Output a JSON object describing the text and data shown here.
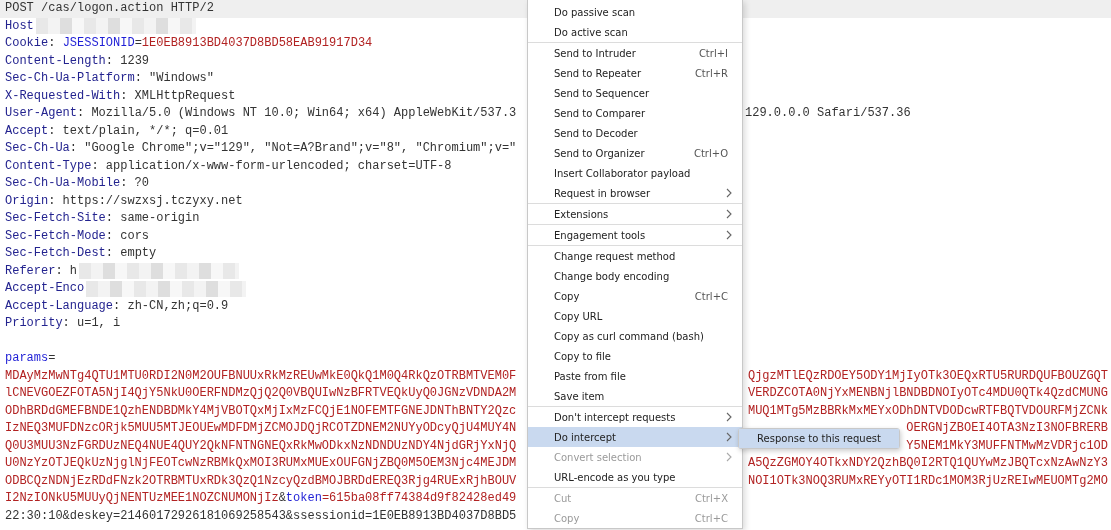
{
  "editor": {
    "lines": [
      {
        "kind": "header",
        "current": true,
        "redacted": false,
        "text": [
          {
            "kind": "plain",
            "text": "POST /cas/logon.action HTTP/2"
          }
        ]
      },
      {
        "kind": "header",
        "current": false,
        "redacted": true,
        "text": [
          {
            "kind": "key",
            "text": "Host"
          }
        ]
      },
      {
        "kind": "header",
        "current": false,
        "redacted": false,
        "text": [
          {
            "kind": "key",
            "text": "Cookie"
          },
          {
            "kind": "plain",
            "text": ": "
          },
          {
            "kind": "param",
            "text": "JSESSIONID"
          },
          {
            "kind": "plain",
            "text": "="
          },
          {
            "kind": "value",
            "text": "1E0EB8913BD4037D8BD58EAB91917D34"
          }
        ]
      },
      {
        "kind": "header",
        "current": false,
        "redacted": false,
        "text": [
          {
            "kind": "key",
            "text": "Content-Length"
          },
          {
            "kind": "plain",
            "text": ": 1239"
          }
        ]
      },
      {
        "kind": "header",
        "current": false,
        "redacted": false,
        "text": [
          {
            "kind": "key",
            "text": "Sec-Ch-Ua-Platform"
          },
          {
            "kind": "plain",
            "text": ": \"Windows\""
          }
        ]
      },
      {
        "kind": "header",
        "current": false,
        "redacted": false,
        "text": [
          {
            "kind": "key",
            "text": "X-Requested-With"
          },
          {
            "kind": "plain",
            "text": ": XMLHttpRequest"
          }
        ]
      },
      {
        "kind": "header",
        "current": false,
        "redacted": false,
        "text": [
          {
            "kind": "key",
            "text": "User-Agent"
          },
          {
            "kind": "plain",
            "text": ": Mozilla/5.0 (Windows NT 10.0; Win64; x64) AppleWebKit/537.3"
          }
        ],
        "tail": [
          {
            "kind": "plain",
            "text": "129.0.0.0 Safari/537.36"
          }
        ]
      },
      {
        "kind": "header",
        "current": false,
        "redacted": false,
        "text": [
          {
            "kind": "key",
            "text": "Accept"
          },
          {
            "kind": "plain",
            "text": ": text/plain, */*; q=0.01"
          }
        ]
      },
      {
        "kind": "header",
        "current": false,
        "redacted": false,
        "text": [
          {
            "kind": "key",
            "text": "Sec-Ch-Ua"
          },
          {
            "kind": "plain",
            "text": ": \"Google Chrome\";v=\"129\", \"Not=A?Brand\";v=\"8\", \"Chromium\";v=\""
          }
        ]
      },
      {
        "kind": "header",
        "current": false,
        "redacted": false,
        "text": [
          {
            "kind": "key",
            "text": "Content-Type"
          },
          {
            "kind": "plain",
            "text": ": application/x-www-form-urlencoded; charset=UTF-8"
          }
        ]
      },
      {
        "kind": "header",
        "current": false,
        "redacted": false,
        "text": [
          {
            "kind": "key",
            "text": "Sec-Ch-Ua-Mobile"
          },
          {
            "kind": "plain",
            "text": ": ?0"
          }
        ]
      },
      {
        "kind": "header",
        "current": false,
        "redacted": false,
        "text": [
          {
            "kind": "key",
            "text": "Origin"
          },
          {
            "kind": "plain",
            "text": ": https://swzxsj.tczyxy.net"
          }
        ]
      },
      {
        "kind": "header",
        "current": false,
        "redacted": false,
        "text": [
          {
            "kind": "key",
            "text": "Sec-Fetch-Site"
          },
          {
            "kind": "plain",
            "text": ": same-origin"
          }
        ]
      },
      {
        "kind": "header",
        "current": false,
        "redacted": false,
        "text": [
          {
            "kind": "key",
            "text": "Sec-Fetch-Mode"
          },
          {
            "kind": "plain",
            "text": ": cors"
          }
        ]
      },
      {
        "kind": "header",
        "current": false,
        "redacted": false,
        "text": [
          {
            "kind": "key",
            "text": "Sec-Fetch-Dest"
          },
          {
            "kind": "plain",
            "text": ": empty"
          }
        ]
      },
      {
        "kind": "header",
        "current": false,
        "redacted": true,
        "text": [
          {
            "kind": "key",
            "text": "Referer"
          },
          {
            "kind": "plain",
            "text": ": h"
          }
        ]
      },
      {
        "kind": "header",
        "current": false,
        "redacted": true,
        "text": [
          {
            "kind": "key",
            "text": "Accept-Enco"
          }
        ]
      },
      {
        "kind": "header",
        "current": false,
        "redacted": false,
        "text": [
          {
            "kind": "key",
            "text": "Accept-Language"
          },
          {
            "kind": "plain",
            "text": ": zh-CN,zh;q=0.9"
          }
        ]
      },
      {
        "kind": "header",
        "current": false,
        "redacted": false,
        "text": [
          {
            "kind": "key",
            "text": "Priority"
          },
          {
            "kind": "plain",
            "text": ": u=1, i"
          }
        ]
      },
      {
        "kind": "blank",
        "current": false,
        "redacted": false
      },
      {
        "kind": "body",
        "current": false,
        "redacted": false,
        "text": [
          {
            "kind": "param",
            "text": "params"
          },
          {
            "kind": "plain",
            "text": "="
          }
        ]
      },
      {
        "kind": "body",
        "current": false,
        "redacted": false,
        "text": [
          {
            "kind": "value",
            "text": "MDAyMzMwNTg4QTU1MTU0RDI2N0M2OUFBNUUxRkMzREUwMkE0QkQ1M0Q4RkQzOTRBMTVEM0F"
          }
        ],
        "tail": [
          {
            "kind": "value",
            "text": "QjgzMTlEQzRDOEY5ODY1MjIyOTk3OEQxRTU5RURDQUFBOUZGQT"
          }
        ]
      },
      {
        "kind": "body",
        "current": false,
        "redacted": false,
        "text": [
          {
            "kind": "value",
            "text": "lCNEVGOEZFOTA5NjI4QjY5NkU0OERFNDMzQjQ2Q0VBQUIwNzBFRTVEQkUyQ0JGNzVDNDA2M"
          }
        ],
        "tail": [
          {
            "kind": "value",
            "text": "VERDZCOTA0NjYxMENBNjlBNDBDNOIyOTc4MDU0QTk4QzdCMUNG"
          }
        ]
      },
      {
        "kind": "body",
        "current": false,
        "redacted": false,
        "text": [
          {
            "kind": "value",
            "text": "ODhBRDdGMEFBNDE1QzhENDBDMkY4MjVBOTQxMjIxMzFCQjE1NOFEMTFGNEJDNThBNTY2Qzc"
          }
        ],
        "tail": [
          {
            "kind": "value",
            "text": "MUQ1MTg5MzBBRkMxMEYxODhDNTVDODcwRTFBQTVDOURFMjZCNk"
          }
        ]
      },
      {
        "kind": "body",
        "current": false,
        "redacted": false,
        "text": [
          {
            "kind": "value",
            "text": "IzNEQ3MUFDNzcORjk5MUU5MTJEOUEwMDFDMjZCMOJDQjRCOTZDNEM2NUYyODcyQjU4MUY4N"
          }
        ],
        "tail": [
          {
            "kind": "value",
            "text": "OERGNjZBOEI4OTA3NzI3NOFBRERB"
          }
        ]
      },
      {
        "kind": "body",
        "current": false,
        "redacted": false,
        "text": [
          {
            "kind": "value",
            "text": "Q0U3MUU3NzFGRDUzNEQ4NUE4QUY2QkNFNTNGNEQxRkMwODkxNzNDNDUzNDY4NjdGRjYxNjQ"
          }
        ],
        "tail": [
          {
            "kind": "value",
            "text": "Y5NEM1MkY3MUFFNTMwMzVDRjc1OD"
          }
        ]
      },
      {
        "kind": "body",
        "current": false,
        "redacted": false,
        "text": [
          {
            "kind": "value",
            "text": "U0NzYzOTJEQkUzNjglNjFEOTcwNzRBMkQxMOI3RUMxMUExOUFGNjZBQ0M5OEM3Njc4MEJDM"
          }
        ],
        "tail": [
          {
            "kind": "value",
            "text": "A5QzZGMOY4OTkxNDY2QzhBQ0I2RTQ1QUYwMzJBQTcxNzAwNzY3"
          }
        ]
      },
      {
        "kind": "body",
        "current": false,
        "redacted": false,
        "text": [
          {
            "kind": "value",
            "text": "ODBCQzNDNjEzRDdFNzk2OTRBMTUxRDk3QzQ1NzcyQzdBMOJBRDdEREQ3Rjg4RUExRjhBOUV"
          }
        ],
        "tail": [
          {
            "kind": "value",
            "text": "NOI1OTk3NOQ3RUMxREYyOTI1RDc1MOM3RjUzREIwMEUOMTg2MO"
          }
        ]
      },
      {
        "kind": "body",
        "current": false,
        "redacted": false,
        "text": [
          {
            "kind": "value",
            "text": "I2NzIONkU5MUUyQjNENTUzMEE1NOZCNUMONjIz"
          },
          {
            "kind": "plain",
            "text": "&"
          },
          {
            "kind": "param",
            "text": "token"
          },
          {
            "kind": "value",
            "text": "=615ba08ff74384d9f82428ed49"
          }
        ]
      },
      {
        "kind": "body",
        "current": false,
        "redacted": false,
        "text": [
          {
            "kind": "plain",
            "text": "22:30:10&deskey=21460172926181069258543&ssessionid=1E0EB8913BD4037D8BD5"
          }
        ]
      }
    ]
  },
  "context_menu": {
    "items": [
      {
        "kind": "item",
        "label": "Do passive scan",
        "selected": false,
        "disabled": false,
        "submenu": false
      },
      {
        "kind": "item",
        "label": "Do active scan",
        "selected": false,
        "disabled": false,
        "submenu": false
      },
      {
        "kind": "separator"
      },
      {
        "kind": "item",
        "label": "Send to Intruder",
        "shortcut": "Ctrl+I",
        "selected": false,
        "disabled": false,
        "submenu": false
      },
      {
        "kind": "item",
        "label": "Send to Repeater",
        "shortcut": "Ctrl+R",
        "selected": false,
        "disabled": false,
        "submenu": false
      },
      {
        "kind": "item",
        "label": "Send to Sequencer",
        "selected": false,
        "disabled": false,
        "submenu": false
      },
      {
        "kind": "item",
        "label": "Send to Comparer",
        "selected": false,
        "disabled": false,
        "submenu": false
      },
      {
        "kind": "item",
        "label": "Send to Decoder",
        "selected": false,
        "disabled": false,
        "submenu": false
      },
      {
        "kind": "item",
        "label": "Send to Organizer",
        "shortcut": "Ctrl+O",
        "selected": false,
        "disabled": false,
        "submenu": false
      },
      {
        "kind": "item",
        "label": "Insert Collaborator payload",
        "selected": false,
        "disabled": false,
        "submenu": false
      },
      {
        "kind": "item",
        "label": "Request in browser",
        "selected": false,
        "disabled": false,
        "submenu": true
      },
      {
        "kind": "separator"
      },
      {
        "kind": "item",
        "label": "Extensions",
        "selected": false,
        "disabled": false,
        "submenu": true
      },
      {
        "kind": "separator"
      },
      {
        "kind": "item",
        "label": "Engagement tools",
        "selected": false,
        "disabled": false,
        "submenu": true
      },
      {
        "kind": "separator"
      },
      {
        "kind": "item",
        "label": "Change request method",
        "selected": false,
        "disabled": false,
        "submenu": false
      },
      {
        "kind": "item",
        "label": "Change body encoding",
        "selected": false,
        "disabled": false,
        "submenu": false
      },
      {
        "kind": "item",
        "label": "Copy",
        "shortcut": "Ctrl+C",
        "selected": false,
        "disabled": false,
        "submenu": false
      },
      {
        "kind": "item",
        "label": "Copy URL",
        "selected": false,
        "disabled": false,
        "submenu": false
      },
      {
        "kind": "item",
        "label": "Copy as curl command (bash)",
        "selected": false,
        "disabled": false,
        "submenu": false
      },
      {
        "kind": "item",
        "label": "Copy to file",
        "selected": false,
        "disabled": false,
        "submenu": false
      },
      {
        "kind": "item",
        "label": "Paste from file",
        "selected": false,
        "disabled": false,
        "submenu": false
      },
      {
        "kind": "item",
        "label": "Save item",
        "selected": false,
        "disabled": false,
        "submenu": false
      },
      {
        "kind": "separator"
      },
      {
        "kind": "item",
        "label": "Don't intercept requests",
        "selected": false,
        "disabled": false,
        "submenu": true
      },
      {
        "kind": "item",
        "label": "Do intercept",
        "selected": true,
        "disabled": false,
        "submenu": true,
        "open_submenu": [
          {
            "label": "Response to this request",
            "selected": true
          }
        ]
      },
      {
        "kind": "item",
        "label": "Convert selection",
        "selected": false,
        "disabled": true,
        "submenu": true
      },
      {
        "kind": "item",
        "label": "URL-encode as you type",
        "selected": false,
        "disabled": false,
        "submenu": false
      },
      {
        "kind": "separator"
      },
      {
        "kind": "item",
        "label": "Cut",
        "shortcut": "Ctrl+X",
        "selected": false,
        "disabled": true,
        "submenu": false
      },
      {
        "kind": "item",
        "label": "Copy",
        "shortcut": "Ctrl+C",
        "selected": false,
        "disabled": true,
        "submenu": false
      }
    ]
  }
}
